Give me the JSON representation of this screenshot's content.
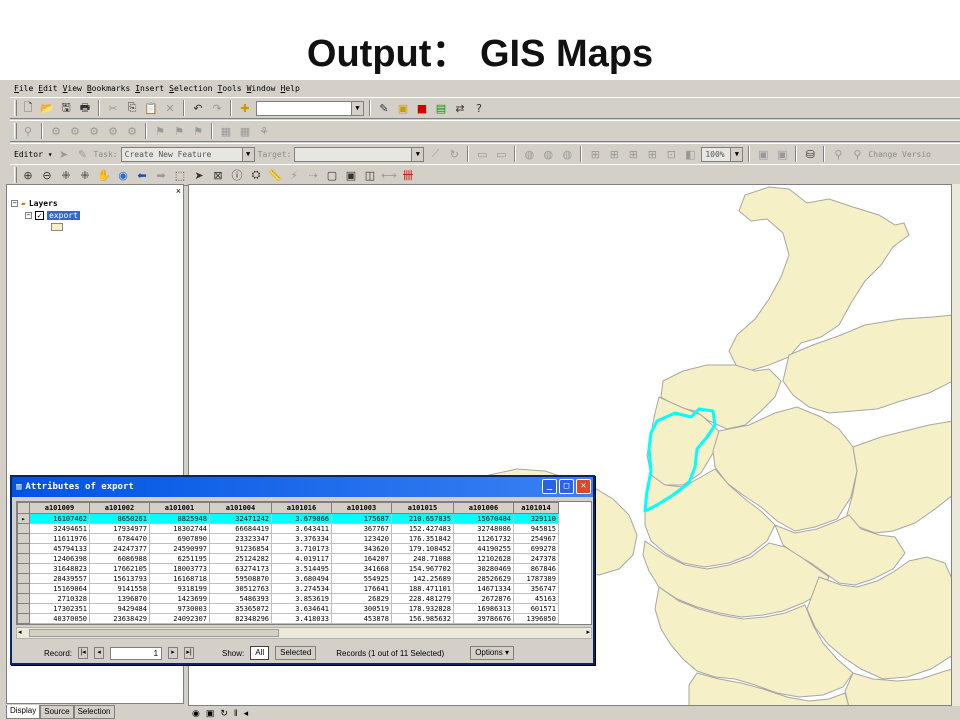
{
  "slide_title": "Output： GIS Maps",
  "menu": [
    "File",
    "Edit",
    "View",
    "Bookmarks",
    "Insert",
    "Selection",
    "Tools",
    "Window",
    "Help"
  ],
  "editor_toolbar": {
    "editor_label": "Editor ▾",
    "task_label": "Task:",
    "task_value": "Create New Feature",
    "target_label": "Target:",
    "target_value": "",
    "zoom_value": "100%",
    "change_version": "Change Versio"
  },
  "toc": {
    "layers_label": "Layers",
    "layer_name": "export",
    "tabs": [
      "Display",
      "Source",
      "Selection"
    ]
  },
  "attributes": {
    "title": "Attributes of export",
    "columns": [
      "a101009",
      "a101002",
      "a101001",
      "a101004",
      "a101016",
      "a101003",
      "a101015",
      "a101006",
      "a101014"
    ],
    "rows": [
      [
        "16107462",
        "8650261",
        "8825948",
        "32471242",
        "3.679066",
        "175687",
        "210.657835",
        "15670484",
        "329110"
      ],
      [
        "32494651",
        "17934977",
        "18302744",
        "66684419",
        "3.643411",
        "367767",
        "152.427483",
        "32748086",
        "945815"
      ],
      [
        "11611976",
        "6784470",
        "6907890",
        "23323347",
        "3.376334",
        "123420",
        "176.351842",
        "11261732",
        "254967"
      ],
      [
        "45794133",
        "24247377",
        "24590997",
        "91236854",
        "3.710173",
        "343620",
        "179.108452",
        "44190255",
        "699278"
      ],
      [
        "12406398",
        "6086988",
        "6251195",
        "25124282",
        "4.019117",
        "164207",
        "248.71088",
        "12102628",
        "247378"
      ],
      [
        "31648823",
        "17662105",
        "18003773",
        "63274173",
        "3.514495",
        "341668",
        "154.967702",
        "30280469",
        "867846"
      ],
      [
        "28439557",
        "15613793",
        "16168718",
        "59508870",
        "3.680494",
        "554925",
        "142.25689",
        "28526629",
        "1787389"
      ],
      [
        "15169064",
        "9141558",
        "9318199",
        "30512763",
        "3.274534",
        "176641",
        "188.471101",
        "14671334",
        "356747"
      ],
      [
        "2710328",
        "1396870",
        "1423699",
        "5486393",
        "3.853619",
        "26829",
        "228.481279",
        "2672876",
        "45163"
      ],
      [
        "17302351",
        "9429484",
        "9730003",
        "35365072",
        "3.634641",
        "300519",
        "178.932828",
        "16986313",
        "601571"
      ],
      [
        "40370050",
        "23638429",
        "24092307",
        "82348296",
        "3.418033",
        "453878",
        "156.985632",
        "39786676",
        "1396050"
      ]
    ],
    "selected_row": 0,
    "record_label": "Record:",
    "record_value": "1",
    "show_label": "Show:",
    "show_all": "All",
    "show_selected": "Selected",
    "records_status": "Records (1 out of 11 Selected)",
    "options_label": "Options ▾"
  },
  "colors": {
    "map_fill": "#f5f0c6",
    "map_stroke": "#a6a6a6",
    "selection": "#00ffff",
    "title_bar": "#0054e3"
  }
}
